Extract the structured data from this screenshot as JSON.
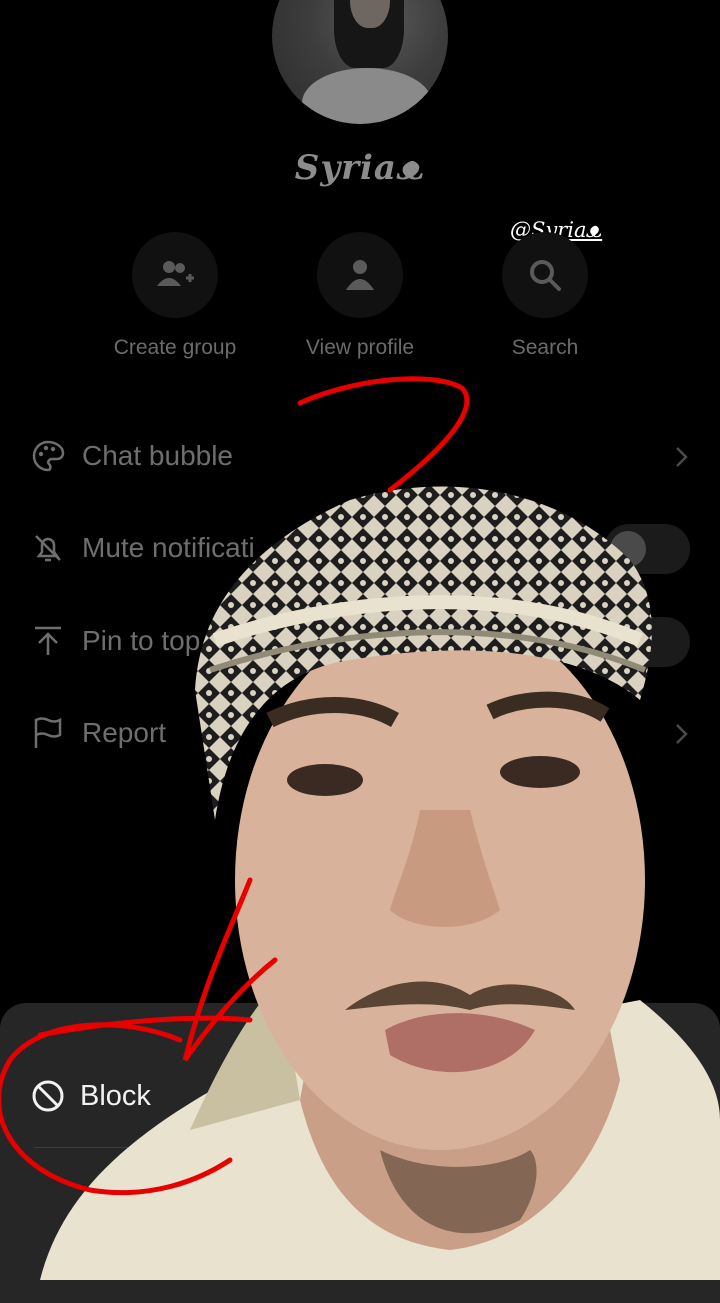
{
  "profile": {
    "name": "Syriaᴥ"
  },
  "watermark": {
    "prefix": "@",
    "handle": "Syriaᴥ"
  },
  "actions": [
    {
      "label": "Create group",
      "icon": "group-add-icon"
    },
    {
      "label": "View profile",
      "icon": "person-icon"
    },
    {
      "label": "Search",
      "icon": "search-icon"
    }
  ],
  "settings": [
    {
      "label": "Chat bubble",
      "icon": "palette-icon",
      "control": "chevron"
    },
    {
      "label": "Mute notificati",
      "icon": "bell-off-icon",
      "control": "toggle",
      "value": false
    },
    {
      "label": "Pin to top",
      "icon": "pin-top-icon",
      "control": "toggle",
      "value": false
    },
    {
      "label": "Report",
      "icon": "flag-icon",
      "control": "chevron"
    }
  ],
  "sheet": {
    "block_label": "Block",
    "icon": "block-icon"
  },
  "colors": {
    "annotation": "#e60000",
    "sheet_bg": "#262626",
    "bg": "#000000"
  }
}
